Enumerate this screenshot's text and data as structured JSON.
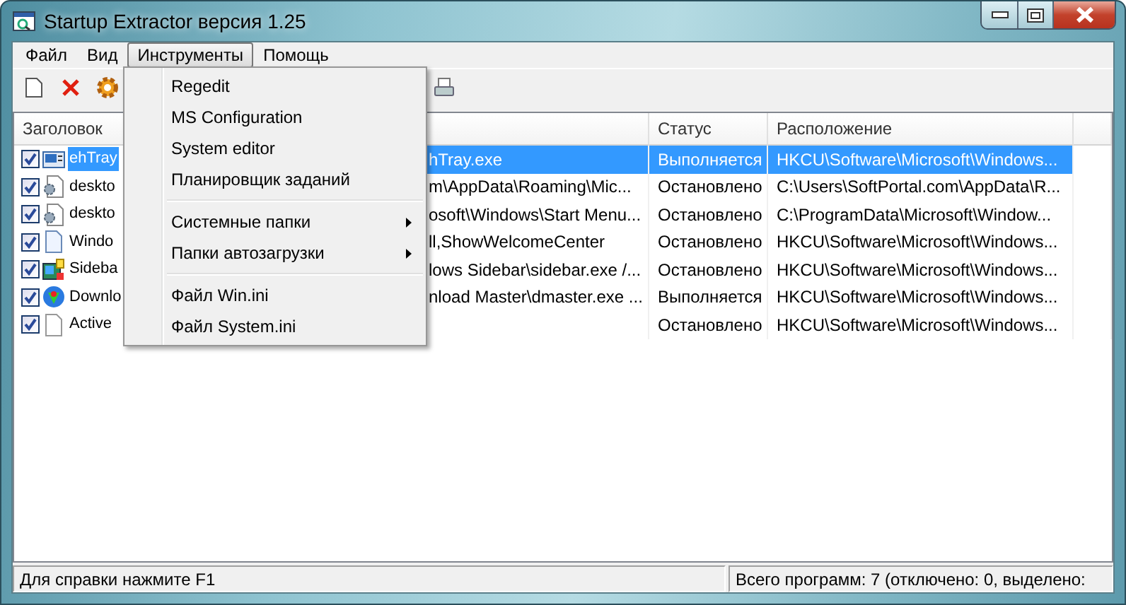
{
  "window": {
    "title": "Startup Extractor версия 1.25"
  },
  "menu_bar": [
    {
      "label": "Файл",
      "selected": false
    },
    {
      "label": "Вид",
      "selected": false
    },
    {
      "label": "Инструменты",
      "selected": true
    },
    {
      "label": "Помощь",
      "selected": false
    }
  ],
  "open_menu": {
    "groups": [
      [
        {
          "label": "Regedit",
          "submenu": false
        },
        {
          "label": "MS Configuration",
          "submenu": false
        },
        {
          "label": "System editor",
          "submenu": false
        },
        {
          "label": "Планировщик заданий",
          "submenu": false
        }
      ],
      [
        {
          "label": "Системные папки",
          "submenu": true
        },
        {
          "label": "Папки автозагрузки",
          "submenu": true
        }
      ],
      [
        {
          "label": "Файл Win.ini",
          "submenu": false
        },
        {
          "label": "Файл System.ini",
          "submenu": false
        }
      ]
    ]
  },
  "table": {
    "columns": {
      "title": "Заголовок",
      "status": "Статус",
      "location": "Расположение"
    },
    "rows": [
      {
        "checked": true,
        "selected": true,
        "title": "ehTray",
        "command": "hTray.exe",
        "status": "Выполняется",
        "location": "HKCU\\Software\\Microsoft\\Windows..."
      },
      {
        "checked": true,
        "selected": false,
        "title": "deskto",
        "command": "m\\AppData\\Roaming\\Mic...",
        "status": "Остановлено",
        "location": "C:\\Users\\SoftPortal.com\\AppData\\R..."
      },
      {
        "checked": true,
        "selected": false,
        "title": "deskto",
        "command": "osoft\\Windows\\Start Menu...",
        "status": "Остановлено",
        "location": "C:\\ProgramData\\Microsoft\\Window..."
      },
      {
        "checked": true,
        "selected": false,
        "title": "Windo",
        "command": "ll,ShowWelcomeCenter",
        "status": "Остановлено",
        "location": "HKCU\\Software\\Microsoft\\Windows..."
      },
      {
        "checked": true,
        "selected": false,
        "title": "Sideba",
        "command": "lows Sidebar\\sidebar.exe /...",
        "status": "Остановлено",
        "location": "HKCU\\Software\\Microsoft\\Windows..."
      },
      {
        "checked": true,
        "selected": false,
        "title": "Downlo",
        "command": "nload Master\\dmaster.exe ...",
        "status": "Выполняется",
        "location": "HKCU\\Software\\Microsoft\\Windows..."
      },
      {
        "checked": true,
        "selected": false,
        "title": "Active",
        "status": "Остановлено",
        "location": "HKCU\\Software\\Microsoft\\Windows..."
      }
    ]
  },
  "status_bar": {
    "help": "Для справки нажмите F1",
    "summary": "Всего программ: 7 (отключено: 0, выделено:"
  }
}
